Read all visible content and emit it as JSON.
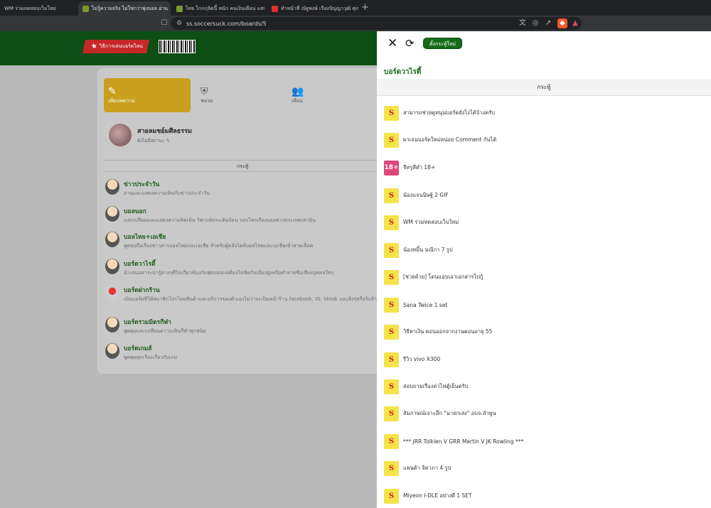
{
  "browser": {
    "tabs": [
      {
        "label": "WM ร่วมทดสอบเว็บใหม่",
        "active": false
      },
      {
        "label": "ไม่รู้ความจริง ไม่ใช่กว่าพุ่งบอล อ่าน",
        "active": true
      },
      {
        "label": "ไทย ไกกกุลิดนี้ หนัก คนเงินเดือน แสน เงิน",
        "active": false
      },
      {
        "label": "ทำหน้าที่ ณัฐพงษ์ เรืองปัญญาวุฒิ ศุภ",
        "active": false
      }
    ],
    "new_tab": "+",
    "url": "ss.soccersuck.com/boards/5"
  },
  "site": {
    "promo_label": "วิธีการเล่นบอร์ดใหม่",
    "nav": [
      {
        "label": "เพิ่มบทความ",
        "icon": "edit-icon"
      },
      {
        "label": "ชมรม",
        "icon": "club-icon"
      },
      {
        "label": "เพื่อน",
        "icon": "friends-icon"
      }
    ],
    "user": {
      "name": "สายลมชย์มศีลธรรม",
      "sub": "ยังไม่มีสถานะ"
    },
    "board_header": "กระทู้",
    "boards": [
      {
        "title": "ข่าวประจำวัน",
        "desc": "อ่านและแสดงความเห็นกับข่าวประจำวัน"
      },
      {
        "title": "บอลนอก",
        "desc": "แลกเปลี่ยนและแสดงความคิดเห็น วิพากษ์ประเด็นร้อน รอบโลกเรื่องบอลต่างประเทศเท่านั้น"
      },
      {
        "title": "บอลไทย+เอเชีย",
        "desc": "พูดคุยถึงเรื่องข่าวสารบอลไทยและเอเชีย สำหรับผู้คลั่งไคล้บอลไทยและเอเชียเข้าสายเลือด"
      },
      {
        "title": "บอร์ดวาไรตี้",
        "desc": "นำเสนอสาระน่ารู้ต่างๆที่ไม่เกี่ยวข้องกับฟุตบอลแต่ต้องไม่ขัดกับเบื้องสูงหรือทำลายชื่อเสียงบุคคลใดๆ"
      },
      {
        "title": "บอร์ดฝากร้าน",
        "desc": "เป็นบอร์ดที่ให้สมาชิกโปรโมทสินค้าและบริการของตัวเองไม่ว่าจะเป็นหน้าร้าน facebook, IG, tiktok และสิ่งๆหรือรับจ้าง"
      },
      {
        "title": "บอร์ดรวมมิตรกีฬา",
        "desc": "พูดคุยแลกเปลี่ยนความเห็นกีฬาทุกชนิด"
      },
      {
        "title": "บอร์ดเกมส์",
        "desc": "พูดคุยทุกเรื่องเกี่ยวกับเกม"
      }
    ]
  },
  "panel": {
    "new_thread_button": "ตั้งกระทู้ใหม่",
    "title": "บอร์ดวาไรตี้",
    "column_header": "กระทู้",
    "threads": [
      {
        "title": "สามารถช่วยดูหนุนบอร์ดยังไงได้บ้างครับ",
        "icon": "S"
      },
      {
        "title": "ผาเจนบอร์ดใหม่หน่อย Comment กันได้",
        "icon": "S"
      },
      {
        "title": "จีทรูสีดำ 18+",
        "icon": "18+"
      },
      {
        "title": "น้องแจนนิษฐ์ 2 GIF",
        "icon": "S"
      },
      {
        "title": "WM ร่วมทดสอบเว็บใหม่",
        "icon": "S"
      },
      {
        "title": "น้องหมิ้น มณีกา 7 รูป",
        "icon": "S"
      },
      {
        "title": "[ช่วยด้วย] โดนแอบเอาเอกสารไปกู้",
        "icon": "S"
      },
      {
        "title": "Sana Twice 1 set",
        "icon": "S"
      },
      {
        "title": "วิธีหาเงิน ตอนออกจากงานตอนอายุ 55",
        "icon": "S"
      },
      {
        "title": "รีวิว vivo X300",
        "icon": "S"
      },
      {
        "title": "สอบถามเรื่องค่าไฟตู้เย็นครับ",
        "icon": "S"
      },
      {
        "title": "สัมภาษณ์เจาะลึก \"นายกเสง\" อบจ.ลำพูน",
        "icon": "S"
      },
      {
        "title": "*** JRR Tolkien V GRR Martin V JK Rowling ***",
        "icon": "S"
      },
      {
        "title": "แพนด้า จิดาภา 4 รูป",
        "icon": "S"
      },
      {
        "title": "Miyeon I-DLE อย่างดี 1 SET",
        "icon": "S"
      }
    ]
  }
}
